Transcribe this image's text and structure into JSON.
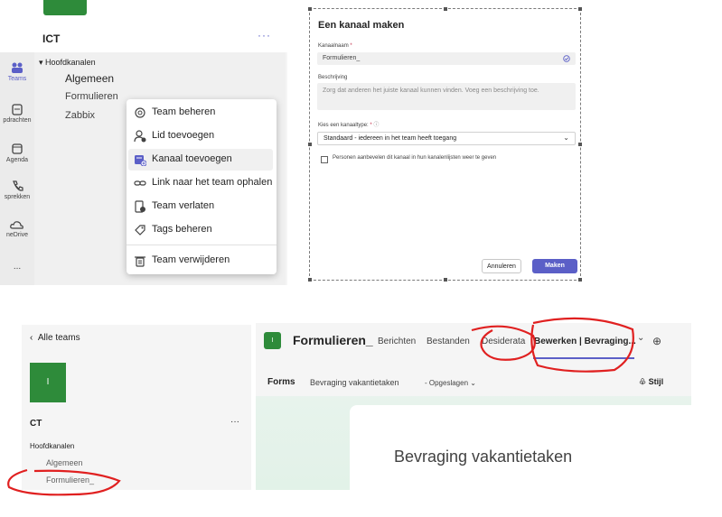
{
  "panel1": {
    "rail": [
      {
        "label": "Teams",
        "icon": "teams-icon"
      },
      {
        "label": "pdrachten",
        "icon": "assignments-icon"
      },
      {
        "label": "Agenda",
        "icon": "calendar-icon"
      },
      {
        "label": "sprekken",
        "icon": "calls-icon"
      },
      {
        "label": "neDrive",
        "icon": "onedrive-icon"
      },
      {
        "label": "...",
        "icon": "more-apps-icon"
      }
    ],
    "team_name": "ICT",
    "more": "···",
    "channels_header": "Hoofdkanalen",
    "channels": [
      "Algemeen",
      "Formulieren",
      "Zabbix"
    ],
    "context_menu": [
      {
        "label": "Team beheren",
        "icon": "gear-icon"
      },
      {
        "label": "Lid toevoegen",
        "icon": "add-person-icon"
      },
      {
        "label": "Kanaal toevoegen",
        "icon": "add-channel-icon"
      },
      {
        "label": "Link naar het team ophalen",
        "icon": "link-icon"
      },
      {
        "label": "Team verlaten",
        "icon": "leave-icon"
      },
      {
        "label": "Tags beheren",
        "icon": "tag-icon"
      },
      {
        "label": "Team verwijderen",
        "icon": "trash-icon"
      }
    ]
  },
  "dialog": {
    "title": "Een kanaal maken",
    "name_label": "Kanaalnaam",
    "name_value": "Formulieren_",
    "desc_label": "Beschrijving",
    "desc_placeholder": "Zorg dat anderen het juiste kanaal kunnen vinden. Voeg een beschrijving toe.",
    "type_label": "Kies een kanaaltype:",
    "type_value": "Standaard - iedereen in het team heeft toegang",
    "checkbox_label": "Personen aanbevelen dit kanaal in hun kanalenlijsten weer te geven",
    "cancel": "Annuleren",
    "create": "Maken",
    "required": "*"
  },
  "panel3": {
    "back": "Alle teams",
    "avatar_letter": "I",
    "team_name": "CT",
    "more": "···",
    "channels_header": "Hoofdkanalen",
    "channels": [
      "Algemeen",
      "Formulieren_"
    ]
  },
  "panel4": {
    "avatar_letter": "I",
    "channel_name": "Formulieren_",
    "tabs": [
      "Berichten",
      "Bestanden",
      "Desiderata",
      "Bewerken | Bevraging..."
    ],
    "tab_overflow": "⌄",
    "add_tab": "⊕",
    "forms_app": "Forms",
    "survey_name": "Bevraging vakantietaken",
    "saved": "- Opgeslagen",
    "style": "Stijl",
    "form_title": "Bevraging vakantietaken"
  },
  "colors": {
    "accent": "#5b5fc7",
    "team_green": "#2e8b3a",
    "annotation_red": "#e02020"
  }
}
